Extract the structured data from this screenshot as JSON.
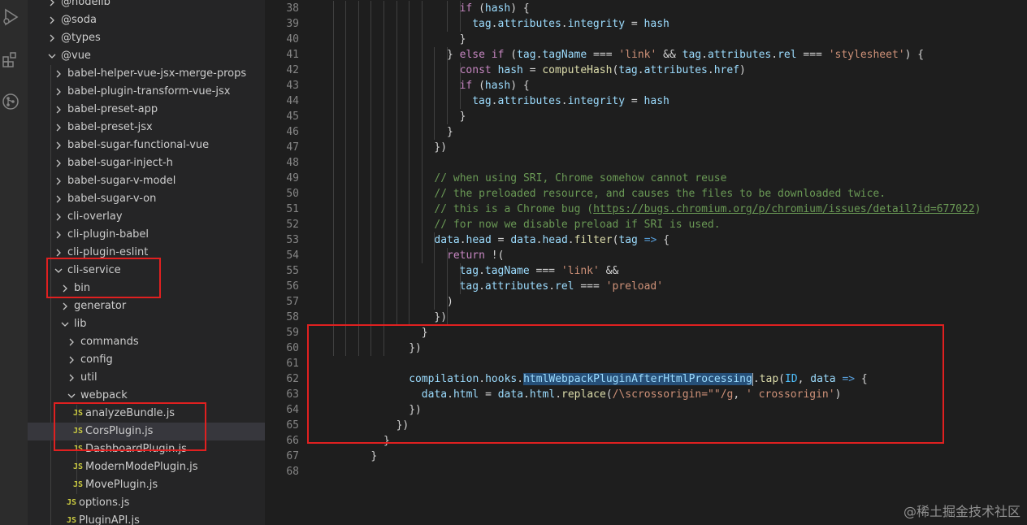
{
  "activity_bar": {
    "icons": [
      "run-debug-icon",
      "extensions-icon",
      "source-control-icon"
    ]
  },
  "explorer": {
    "items": [
      {
        "label": "@nodelib",
        "expanded": false
      },
      {
        "label": "@soda",
        "expanded": false
      },
      {
        "label": "@types",
        "expanded": false
      },
      {
        "label": "@vue",
        "expanded": true
      },
      {
        "label": "babel-helper-vue-jsx-merge-props",
        "expanded": false
      },
      {
        "label": "babel-plugin-transform-vue-jsx",
        "expanded": false
      },
      {
        "label": "babel-preset-app",
        "expanded": false
      },
      {
        "label": "babel-preset-jsx",
        "expanded": false
      },
      {
        "label": "babel-sugar-functional-vue",
        "expanded": false
      },
      {
        "label": "babel-sugar-inject-h",
        "expanded": false
      },
      {
        "label": "babel-sugar-v-model",
        "expanded": false
      },
      {
        "label": "babel-sugar-v-on",
        "expanded": false
      },
      {
        "label": "cli-overlay",
        "expanded": false
      },
      {
        "label": "cli-plugin-babel",
        "expanded": false
      },
      {
        "label": "cli-plugin-eslint",
        "expanded": false
      },
      {
        "label": "cli-service",
        "expanded": true
      },
      {
        "label": "bin",
        "expanded": false
      },
      {
        "label": "generator",
        "expanded": false
      },
      {
        "label": "lib",
        "expanded": true
      },
      {
        "label": "commands",
        "expanded": false
      },
      {
        "label": "config",
        "expanded": false
      },
      {
        "label": "util",
        "expanded": false
      },
      {
        "label": "webpack",
        "expanded": true
      },
      {
        "label": "analyzeBundle.js",
        "file_icon": "JS"
      },
      {
        "label": "CorsPlugin.js",
        "file_icon": "JS",
        "selected": true
      },
      {
        "label": "DashboardPlugin.js",
        "file_icon": "JS"
      },
      {
        "label": "ModernModePlugin.js",
        "file_icon": "JS"
      },
      {
        "label": "MovePlugin.js",
        "file_icon": "JS"
      },
      {
        "label": "options.js",
        "file_icon": "JS"
      },
      {
        "label": "PluginAPI.js",
        "file_icon": "JS"
      }
    ]
  },
  "editor": {
    "lines": [
      {
        "num": "38",
        "text": "if (hash) {"
      },
      {
        "num": "39",
        "text": "tag.attributes.integrity = hash"
      },
      {
        "num": "40",
        "text": "}"
      },
      {
        "num": "41",
        "text": "} else if (tag.tagName === 'link' && tag.attributes.rel === 'stylesheet') {"
      },
      {
        "num": "42",
        "text": "const hash = computeHash(tag.attributes.href)"
      },
      {
        "num": "43",
        "text": "if (hash) {"
      },
      {
        "num": "44",
        "text": "tag.attributes.integrity = hash"
      },
      {
        "num": "45",
        "text": "}"
      },
      {
        "num": "46",
        "text": "}"
      },
      {
        "num": "47",
        "text": "})"
      },
      {
        "num": "48",
        "text": ""
      },
      {
        "num": "49",
        "text": "// when using SRI, Chrome somehow cannot reuse"
      },
      {
        "num": "50",
        "text": "// the preloaded resource, and causes the files to be downloaded twice."
      },
      {
        "num": "51",
        "text": "// this is a Chrome bug (https://bugs.chromium.org/p/chromium/issues/detail?id=677022)"
      },
      {
        "num": "52",
        "text": "// for now we disable preload if SRI is used."
      },
      {
        "num": "53",
        "text": "data.head = data.head.filter(tag => {"
      },
      {
        "num": "54",
        "text": "return !("
      },
      {
        "num": "55",
        "text": "tag.tagName === 'link' &&"
      },
      {
        "num": "56",
        "text": "tag.attributes.rel === 'preload'"
      },
      {
        "num": "57",
        "text": ")"
      },
      {
        "num": "58",
        "text": "})"
      },
      {
        "num": "59",
        "text": "}"
      },
      {
        "num": "60",
        "text": "})"
      },
      {
        "num": "61",
        "text": ""
      },
      {
        "num": "62",
        "text": "compilation.hooks.htmlWebpackPluginAfterHtmlProcessing.tap(ID, data => {"
      },
      {
        "num": "63",
        "text": "data.html = data.html.replace(/\\scrossorigin=\"\"/g, ' crossorigin')"
      },
      {
        "num": "64",
        "text": "})"
      },
      {
        "num": "65",
        "text": "})"
      },
      {
        "num": "66",
        "text": "}"
      },
      {
        "num": "67",
        "text": "}"
      },
      {
        "num": "68",
        "text": ""
      }
    ],
    "selected_word": "htmlWebpackPluginAfterHtmlProcessing"
  },
  "watermark": "@稀土掘金技术社区",
  "colors": {
    "annotation": "#e02020",
    "keyword": "#c586c0",
    "string": "#ce9178",
    "comment": "#6a9955",
    "function": "#dcdcaa",
    "variable": "#9cdcfe"
  }
}
